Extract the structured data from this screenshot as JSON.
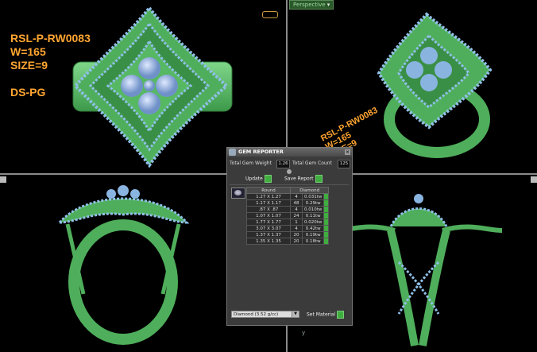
{
  "viewport_labels": {
    "perspective": "Perspective"
  },
  "ring_text": {
    "sku": "RSL-P-RW0083",
    "weight": "W=165",
    "size": "SIZE=9",
    "alloy": "DS-PG",
    "rot_sku": "RSL-P-RW0083",
    "rot_weight": "W=165",
    "rot_size": "SIZE=9",
    "rot_alloy": "PG"
  },
  "axis": {
    "y": "y"
  },
  "gem_reporter": {
    "title": "GEM REPORTER",
    "total_weight_label": "Total Gem Weight",
    "total_weight_value": "1.26",
    "total_count_label": "Total Gem Count",
    "total_count_value": "125",
    "update_label": "Update",
    "save_report_label": "Save Report",
    "columns": [
      "Round",
      "Diamond"
    ],
    "rows": [
      {
        "size": "1.27 X 1.27",
        "count": "4",
        "weight": "0.031tw"
      },
      {
        "size": "1.17 X 1.17",
        "count": "48",
        "weight": "0.29tw"
      },
      {
        "size": ".87 X .87",
        "count": "4",
        "weight": "0.010tw"
      },
      {
        "size": "1.07 X 1.07",
        "count": "24",
        "weight": "0.11tw"
      },
      {
        "size": "1.77 X 1.77",
        "count": "1",
        "weight": "0.020tw"
      },
      {
        "size": "3.07 X 3.07",
        "count": "4",
        "weight": "0.42tw"
      },
      {
        "size": "1.37 X 1.37",
        "count": "20",
        "weight": "0.19tw"
      },
      {
        "size": "1.35 X 1.35",
        "count": "20",
        "weight": "0.18tw"
      }
    ],
    "material_select": "Diamond    (3.52 g/cc)",
    "set_material_label": "Set Material"
  },
  "colors": {
    "metal": "#5fbf6a",
    "gem": "#8ab4e0",
    "text": "#ffa531"
  }
}
